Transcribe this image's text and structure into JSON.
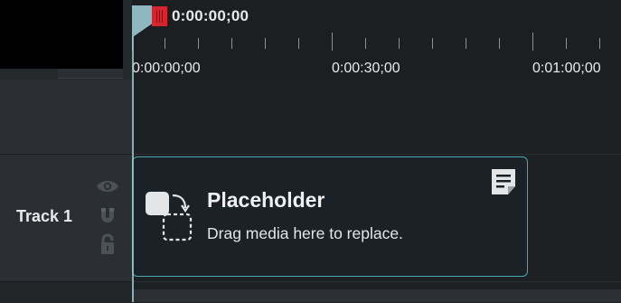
{
  "timeline": {
    "playhead_time": "0:00:00;00",
    "ruler_labels": [
      "0:00:00;00",
      "0:00:30;00",
      "0:01:00;00"
    ]
  },
  "track": {
    "name": "Track 1"
  },
  "clip": {
    "title": "Placeholder",
    "subtitle": "Drag media here to replace."
  },
  "icons": {
    "visibility": "eye-icon",
    "magnetic": "magnet-icon",
    "lock": "lock-icon",
    "placeholder": "placeholder-icon",
    "note": "note-icon"
  },
  "colors": {
    "clip_border": "#4aa6b0",
    "playhead_marker": "#d4262e",
    "background": "#1e2124"
  }
}
